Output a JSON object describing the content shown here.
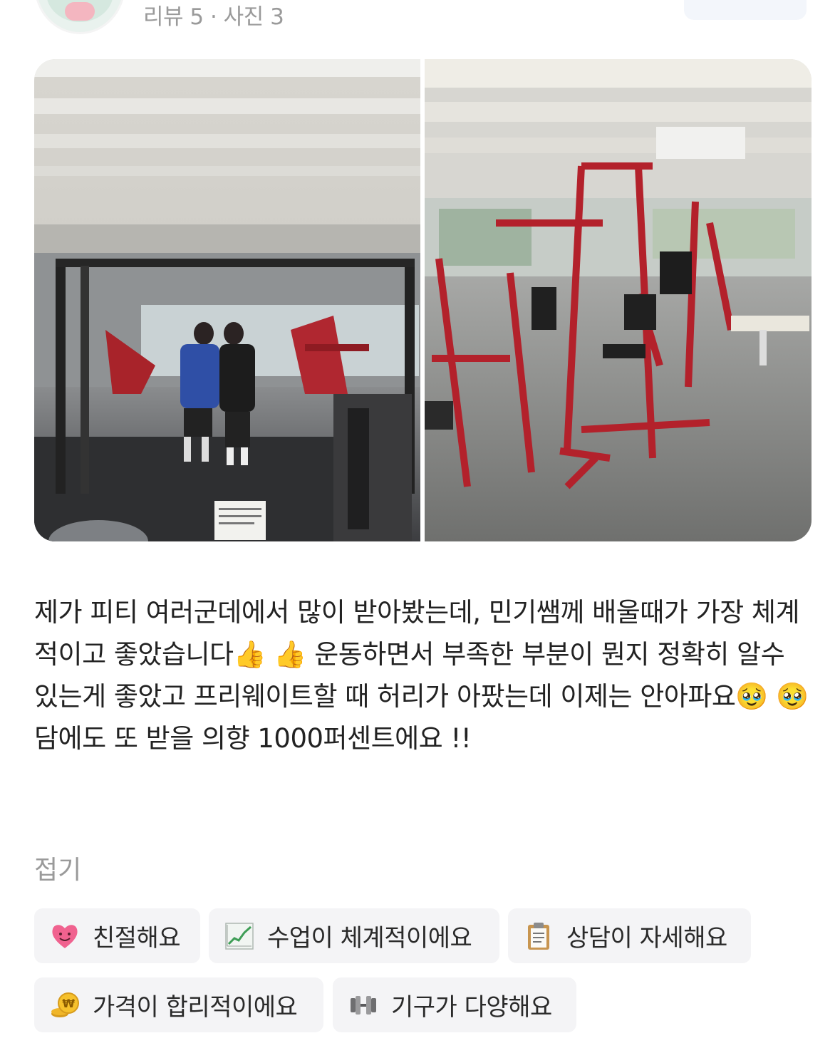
{
  "header": {
    "reviewer_stats": "리뷰 5 · 사진 3"
  },
  "photos": [
    {
      "alt_icon": "gym-mirror-selfie-photo"
    },
    {
      "alt_icon": "gym-machines-photo"
    }
  ],
  "review": {
    "body": "제가 피티 여러군데에서 많이 받아봤는데, 민기쌤께 배울때가 가장 체계적이고 좋았습니다👍 👍 운동하면서 부족한 부분이 뭔지 정확히 알수 있는게 좋았고 프리웨이트할 때 허리가 아팠는데 이제는 안아파요🥹 🥹\n담에도 또 받을 의향 1000퍼센트에요 !!",
    "fold_label": "접기"
  },
  "tags": [
    {
      "icon": "heart-face-icon",
      "label": "친절해요"
    },
    {
      "icon": "chart-increasing-icon",
      "label": "수업이 체계적이에요"
    },
    {
      "icon": "clipboard-icon",
      "label": "상담이 자세해요"
    },
    {
      "icon": "coin-icon",
      "label": "가격이 합리적이에요"
    },
    {
      "icon": "dumbbell-icon",
      "label": "기구가 다양해요"
    }
  ],
  "colors": {
    "tag_background": "#f4f4f6",
    "muted_text": "#9a9a9a",
    "machine_red": "#b3212b"
  }
}
